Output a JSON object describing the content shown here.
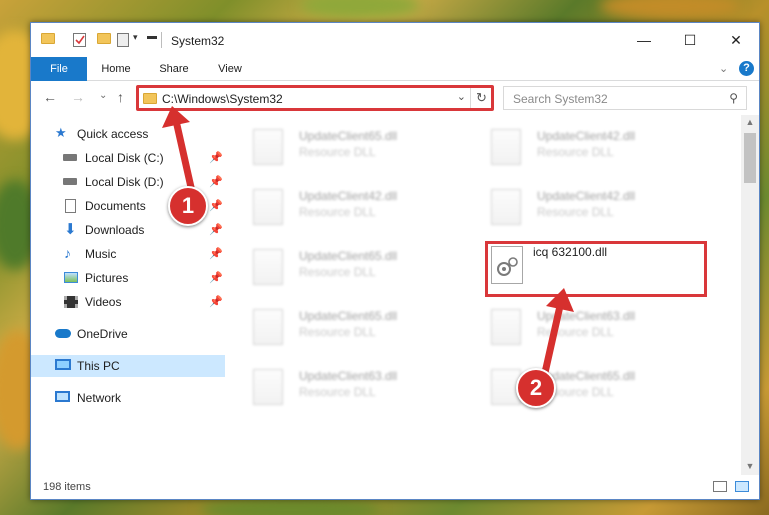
{
  "window": {
    "title": "System32"
  },
  "ribbon": {
    "tabs": [
      "File",
      "Home",
      "Share",
      "View"
    ]
  },
  "address": {
    "path": "C:\\Windows\\System32"
  },
  "search": {
    "placeholder": "Search System32"
  },
  "nav": {
    "items": [
      {
        "label": "Quick access",
        "icon": "star-icon",
        "pinned": false
      },
      {
        "label": "Local Disk (C:)",
        "icon": "drive-icon",
        "pinned": true
      },
      {
        "label": "Local Disk (D:)",
        "icon": "drive-icon",
        "pinned": true
      },
      {
        "label": "Documents",
        "icon": "document-icon",
        "pinned": true
      },
      {
        "label": "Downloads",
        "icon": "download-icon",
        "pinned": true
      },
      {
        "label": "Music",
        "icon": "music-icon",
        "pinned": true
      },
      {
        "label": "Pictures",
        "icon": "pictures-icon",
        "pinned": true
      },
      {
        "label": "Videos",
        "icon": "video-icon",
        "pinned": true
      },
      {
        "label": "OneDrive",
        "icon": "cloud-icon",
        "pinned": false
      },
      {
        "label": "This PC",
        "icon": "computer-icon",
        "pinned": false,
        "selected": true
      },
      {
        "label": "Network",
        "icon": "network-icon",
        "pinned": false
      }
    ]
  },
  "files": {
    "left": [
      {
        "name": "UpdateClient65.dll",
        "type": "Resource DLL"
      },
      {
        "name": "UpdateClient42.dll",
        "type": "Resource DLL"
      },
      {
        "name": "UpdateClient65.dll",
        "type": "Resource DLL"
      },
      {
        "name": "UpdateClient65.dll",
        "type": "Resource DLL"
      },
      {
        "name": "UpdateClient63.dll",
        "type": "Resource DLL"
      }
    ],
    "right": [
      {
        "name": "UpdateClient42.dll",
        "type": "Resource DLL"
      },
      {
        "name": "UpdateClient42.dll",
        "type": "Resource DLL"
      },
      {
        "name": "UpdateClient63.dll",
        "type": "Resource DLL"
      },
      {
        "name": "UpdateClient65.dll",
        "type": "Resource DLL"
      }
    ],
    "highlighted": {
      "name": "icq 632100.dll"
    }
  },
  "status": {
    "count": "198 items"
  },
  "callouts": [
    "1",
    "2"
  ],
  "colors": {
    "accent": "#1979ca",
    "highlight": "#d9373a",
    "selection": "#cce8ff"
  }
}
